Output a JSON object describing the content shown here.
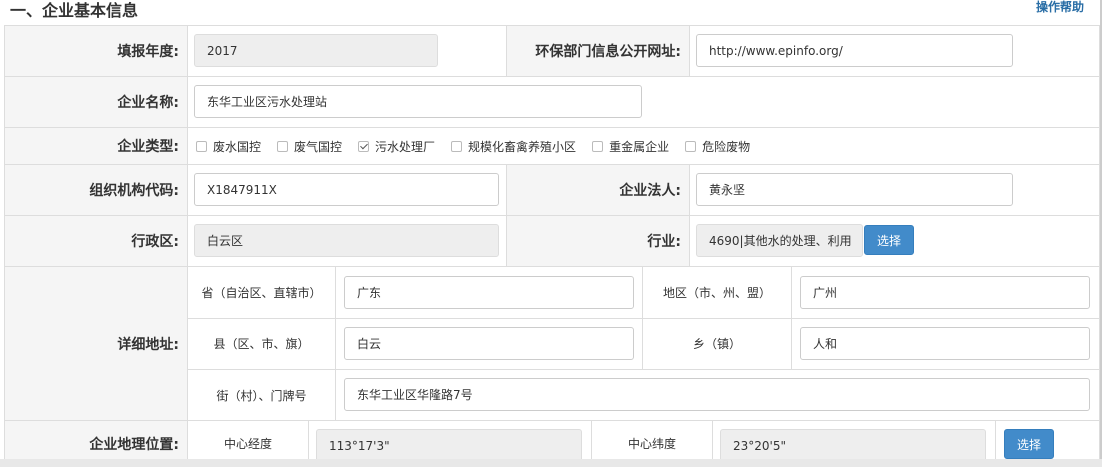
{
  "header": {
    "section_title": "一、企业基本信息",
    "help_link": "操作帮助"
  },
  "form": {
    "year": {
      "label": "填报年度:",
      "value": "2017"
    },
    "env_url": {
      "label": "环保部门信息公开网址:",
      "value": "http://www.epinfo.org/"
    },
    "company_name": {
      "label": "企业名称:",
      "value": "东华工业区污水处理站"
    },
    "company_type": {
      "label": "企业类型:",
      "options": [
        {
          "label": "废水国控",
          "checked": false
        },
        {
          "label": "废气国控",
          "checked": false
        },
        {
          "label": "污水处理厂",
          "checked": true
        },
        {
          "label": "规模化畜禽养殖小区",
          "checked": false
        },
        {
          "label": "重金属企业",
          "checked": false
        },
        {
          "label": "危险废物",
          "checked": false
        }
      ]
    },
    "org_code": {
      "label": "组织机构代码:",
      "value": "X1847911X"
    },
    "legal_person": {
      "label": "企业法人:",
      "value": "黄永坚"
    },
    "district": {
      "label": "行政区:",
      "value": "白云区"
    },
    "industry": {
      "label": "行业:",
      "value": "4690|其他水的处理、利用",
      "select_button": "选择"
    },
    "address": {
      "label": "详细地址:",
      "province_label": "省（自治区、直辖市）",
      "province": "广东",
      "region_label": "地区（市、州、盟）",
      "region": "广州",
      "county_label": "县（区、市、旗）",
      "county": "白云",
      "town_label": "乡（镇）",
      "town": "人和",
      "street_label": "街（村）、门牌号",
      "street": "东华工业区华隆路7号"
    },
    "location": {
      "label": "企业地理位置:",
      "lng_label": "中心经度",
      "lng": "113°17'3\"",
      "lat_label": "中心纬度",
      "lat": "23°20'5\"",
      "select_button": "选择"
    }
  }
}
